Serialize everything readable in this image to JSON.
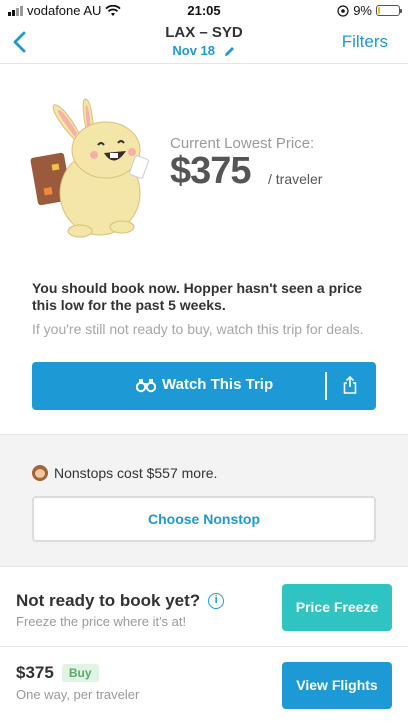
{
  "status": {
    "carrier": "vodafone AU",
    "time": "21:05",
    "battery": "9%"
  },
  "nav": {
    "route": "LAX – SYD",
    "date": "Nov 18",
    "filters": "Filters"
  },
  "hero": {
    "price_label": "Current Lowest Price:",
    "price": "$375",
    "unit": "/ traveler"
  },
  "advice": {
    "headline": "You should book now. Hopper hasn't seen a price this low for the past 5 weeks.",
    "sub": "If you're still not ready to buy, watch this trip for deals."
  },
  "watch": {
    "label": "Watch This Trip"
  },
  "nonstop": {
    "text": "Nonstops cost $557 more.",
    "button": "Choose Nonstop"
  },
  "freeze": {
    "title": "Not ready to book yet?",
    "sub": "Freeze the price where it's at!",
    "button": "Price Freeze"
  },
  "bottom": {
    "price": "$375",
    "badge": "Buy",
    "sub": "One way, per traveler",
    "button": "View Flights"
  },
  "colors": {
    "accent": "#1d9ad6",
    "teal": "#2fc4c1",
    "buy_badge_bg": "#dff4e4"
  }
}
